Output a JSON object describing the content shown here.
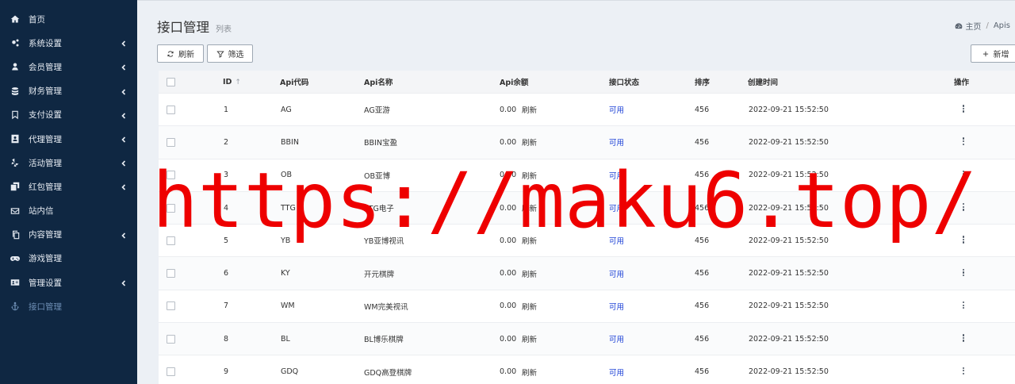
{
  "sidebar": {
    "items": [
      {
        "label": "首页",
        "icon": "home-icon",
        "chevron": false,
        "active": false
      },
      {
        "label": "系统设置",
        "icon": "gears-icon",
        "chevron": true,
        "active": false
      },
      {
        "label": "会员管理",
        "icon": "user-icon",
        "chevron": true,
        "active": false
      },
      {
        "label": "财务管理",
        "icon": "database-icon",
        "chevron": true,
        "active": false
      },
      {
        "label": "支付设置",
        "icon": "bookmark-icon",
        "chevron": true,
        "active": false
      },
      {
        "label": "代理管理",
        "icon": "contact-icon",
        "chevron": true,
        "active": false
      },
      {
        "label": "活动管理",
        "icon": "yelp-icon",
        "chevron": true,
        "active": false
      },
      {
        "label": "红包管理",
        "icon": "clone-icon",
        "chevron": true,
        "active": false
      },
      {
        "label": "站内信",
        "icon": "envelope-icon",
        "chevron": false,
        "active": false
      },
      {
        "label": "内容管理",
        "icon": "copy-icon",
        "chevron": true,
        "active": false
      },
      {
        "label": "游戏管理",
        "icon": "gamepad-icon",
        "chevron": false,
        "active": false
      },
      {
        "label": "管理设置",
        "icon": "id-card-icon",
        "chevron": true,
        "active": false
      },
      {
        "label": "接口管理",
        "icon": "anchor-icon",
        "chevron": false,
        "active": true
      }
    ]
  },
  "header": {
    "title": "接口管理",
    "subtitle": "列表",
    "breadcrumb_home": "主页",
    "breadcrumb_sep": "/",
    "breadcrumb_current": "Apis"
  },
  "toolbar": {
    "refresh_label": "刷新",
    "filter_label": "筛选",
    "add_label": "新增"
  },
  "table": {
    "columns": [
      "ID",
      "Api代码",
      "Api名称",
      "Api余额",
      "接口状态",
      "排序",
      "创建时间",
      "操作"
    ],
    "refresh_label": "刷新",
    "rows": [
      {
        "id": "1",
        "code": "AG",
        "name": "AG亚游",
        "balance": "0.00",
        "status": "可用",
        "sort": "456",
        "created": "2022-09-21 15:52:50"
      },
      {
        "id": "2",
        "code": "BBIN",
        "name": "BBIN宝盈",
        "balance": "0.00",
        "status": "可用",
        "sort": "456",
        "created": "2022-09-21 15:52:50"
      },
      {
        "id": "3",
        "code": "OB",
        "name": "OB亚博",
        "balance": "0.00",
        "status": "可用",
        "sort": "456",
        "created": "2022-09-21 15:52:50"
      },
      {
        "id": "4",
        "code": "TTG",
        "name": "TTG电子",
        "balance": "0.00",
        "status": "可用",
        "sort": "456",
        "created": "2022-09-21 15:52:50"
      },
      {
        "id": "5",
        "code": "YB",
        "name": "YB亚博视讯",
        "balance": "0.00",
        "status": "可用",
        "sort": "456",
        "created": "2022-09-21 15:52:50"
      },
      {
        "id": "6",
        "code": "KY",
        "name": "开元棋牌",
        "balance": "0.00",
        "status": "可用",
        "sort": "456",
        "created": "2022-09-21 15:52:50"
      },
      {
        "id": "7",
        "code": "WM",
        "name": "WM完美视讯",
        "balance": "0.00",
        "status": "可用",
        "sort": "456",
        "created": "2022-09-21 15:52:50"
      },
      {
        "id": "8",
        "code": "BL",
        "name": "BL博乐棋牌",
        "balance": "0.00",
        "status": "可用",
        "sort": "456",
        "created": "2022-09-21 15:52:50"
      },
      {
        "id": "9",
        "code": "GDQ",
        "name": "GDQ高登棋牌",
        "balance": "0.00",
        "status": "可用",
        "sort": "456",
        "created": "2022-09-21 15:52:50"
      }
    ]
  },
  "watermark": "https://maku6.top/",
  "colors": {
    "sidebar_bg": "#0f2742",
    "status_link": "#1a3fd6",
    "watermark": "#ee0000"
  }
}
